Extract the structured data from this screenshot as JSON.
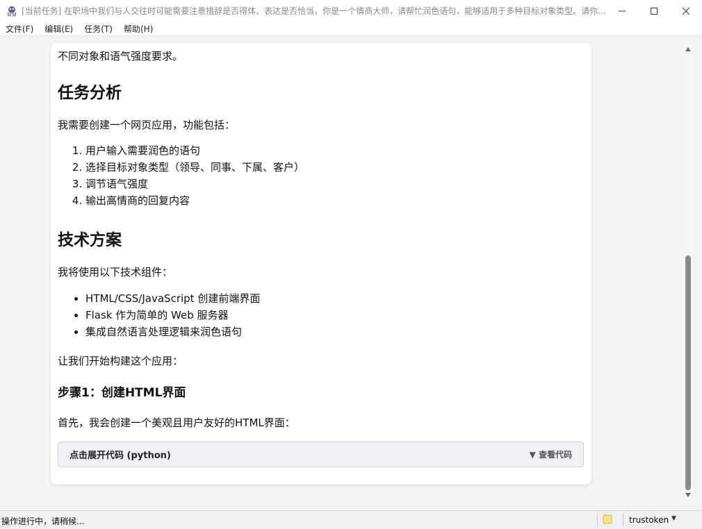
{
  "window": {
    "title": "[当前任务] 在职场中我们与人交往时可能需要注意措辞是否得体、表达是否恰当，你是一个情商大师，请帮忙润色语句，能够适用于多种目标对象类型。请你...",
    "app_icon": "octopus-icon",
    "controls": {
      "minimize_icon": "minimize-icon",
      "maximize_icon": "maximize-icon",
      "close_icon": "close-icon"
    }
  },
  "menu": {
    "file": "文件(F)",
    "edit": "编辑(E)",
    "task": "任务(T)",
    "help": "帮助(H)"
  },
  "content": {
    "intro_tail": "不同对象和语气强度要求。",
    "h_task": "任务分析",
    "task_intro": "我需要创建一个网页应用，功能包括：",
    "task_items": [
      "用户输入需要润色的语句",
      "选择目标对象类型（领导、同事、下属、客户）",
      "调节语气强度",
      "输出高情商的回复内容"
    ],
    "h_tech": "技术方案",
    "tech_intro": "我将使用以下技术组件：",
    "tech_items": [
      "HTML/CSS/JavaScript 创建前端界面",
      "Flask 作为简单的 Web 服务器",
      "集成自然语言处理逻辑来润色语句"
    ],
    "lets_start": "让我们开始构建这个应用：",
    "h_step1": "步骤1：创建HTML界面",
    "step1_intro": "首先，我会创建一个美观且用户友好的HTML界面：",
    "code_block": {
      "title": "点击展开代码 (python)",
      "toggle": "▼ 查看代码"
    }
  },
  "statusbar": {
    "status": "操作进行中，请稍候...",
    "folder_icon": "folder-icon",
    "token_label": "trustoken",
    "dropdown_icon": "caret-down-icon"
  }
}
